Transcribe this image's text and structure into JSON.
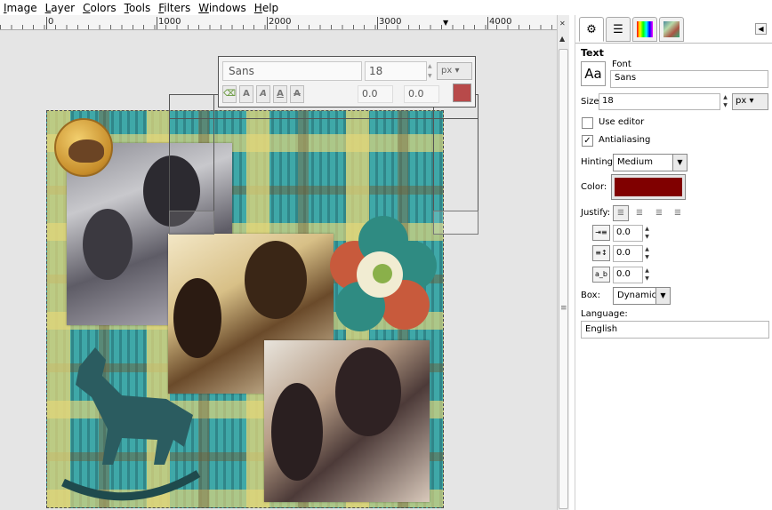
{
  "menubar": {
    "items": [
      "Image",
      "Layer",
      "Colors",
      "Tools",
      "Filters",
      "Windows",
      "Help"
    ]
  },
  "ruler": {
    "labels": [
      "0",
      "1000",
      "2000",
      "3000",
      "4000"
    ]
  },
  "text_toolbox": {
    "font": "Sans",
    "size": "18",
    "unit": "px",
    "baseline": "0.0",
    "kerning": "0.0",
    "color": "#b84a4a",
    "style_buttons": [
      "A",
      "A",
      "A",
      "A"
    ]
  },
  "dock": {
    "tabs": [
      "tool-options-icon",
      "layers-icon",
      "colors-icon",
      "brushes-icon"
    ],
    "title": "Text",
    "font_label": "Font",
    "font_preview": "Aa",
    "font_value": "Sans",
    "size_label": "Size:",
    "size_value": "18",
    "size_unit": "px",
    "use_editor_label": "Use editor",
    "use_editor_checked": false,
    "antialiasing_label": "Antialiasing",
    "antialiasing_checked": true,
    "hinting_label": "Hinting:",
    "hinting_value": "Medium",
    "color_label": "Color:",
    "color_value": "#800000",
    "justify_label": "Justify:",
    "indent_value": "0.0",
    "line_spacing_value": "0.0",
    "letter_spacing_value": "0.0",
    "box_label": "Box:",
    "box_value": "Dynamic",
    "language_label": "Language:",
    "language_value": "English"
  }
}
